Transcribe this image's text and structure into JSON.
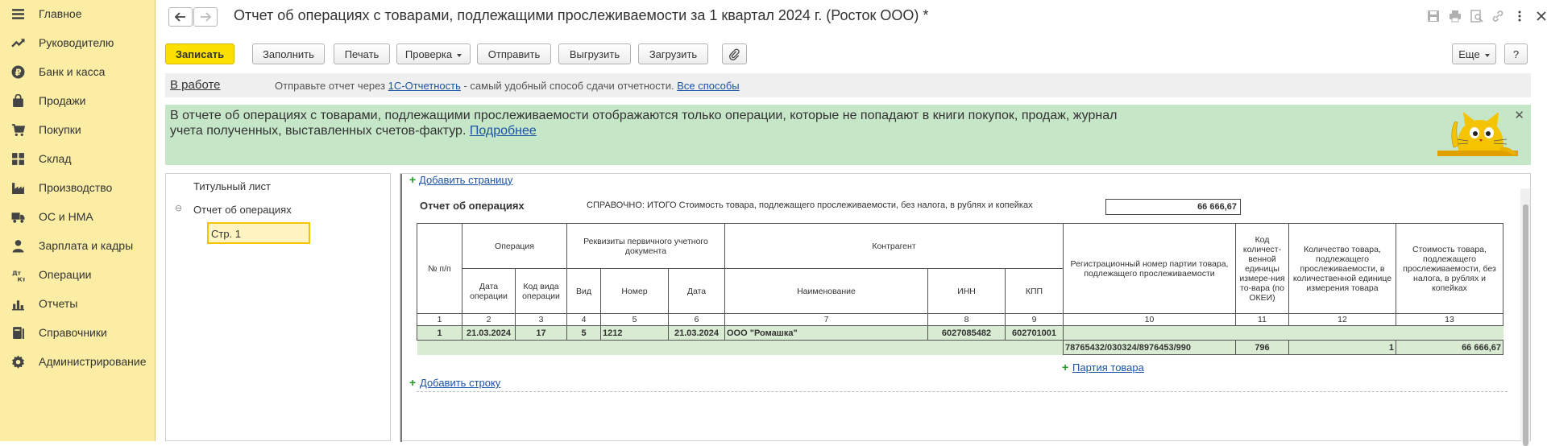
{
  "sidebar": {
    "items": [
      {
        "label": "Главное",
        "icon": "menu-icon"
      },
      {
        "label": "Руководителю",
        "icon": "trend-icon"
      },
      {
        "label": "Банк и касса",
        "icon": "ruble-icon"
      },
      {
        "label": "Продажи",
        "icon": "bag-icon"
      },
      {
        "label": "Покупки",
        "icon": "cart-icon"
      },
      {
        "label": "Склад",
        "icon": "grid-icon"
      },
      {
        "label": "Производство",
        "icon": "factory-icon"
      },
      {
        "label": "ОС и НМА",
        "icon": "truck-icon"
      },
      {
        "label": "Зарплата и кадры",
        "icon": "person-icon"
      },
      {
        "label": "Операции",
        "icon": "dtkt-icon"
      },
      {
        "label": "Отчеты",
        "icon": "barchart-icon"
      },
      {
        "label": "Справочники",
        "icon": "book-icon"
      },
      {
        "label": "Администрирование",
        "icon": "gear-icon"
      }
    ]
  },
  "header": {
    "title": "Отчет об операциях с товарами, подлежащими прослеживаемости за 1 квартал 2024 г. (Росток ООО) *"
  },
  "toolbar": {
    "save": "Записать",
    "fill": "Заполнить",
    "print": "Печать",
    "check": "Проверка",
    "send": "Отправить",
    "export": "Выгрузить",
    "import": "Загрузить",
    "more": "Еще",
    "help": "?"
  },
  "status": {
    "state": "В работе",
    "msg_prefix": "Отправьте отчет через ",
    "msg_link": "1С-Отчетность",
    "msg_middle": " - самый удобный способ сдачи отчетности. ",
    "msg_link2": "Все способы"
  },
  "banner": {
    "text": "В отчете об операциях с товарами, подлежащими прослеживаемости отображаются только операции, которые не попадают в книги покупок, продаж, журнал учета полученных, выставленных счетов-фактур. ",
    "link": "Подробнее"
  },
  "tree": {
    "title_page": "Титульный лист",
    "section": "Отчет об операциях",
    "page": "Стр. 1"
  },
  "form": {
    "add_page": "Добавить страницу",
    "section_title": "Отчет об операциях",
    "ref_label": "СПРАВОЧНО: ИТОГО Стоимость товара, подлежащего прослеживаемости, без налога, в рублях и копейках",
    "ref_total": "66 666,67",
    "add_row": "Добавить строку",
    "add_batch": "Партия товара",
    "columns": {
      "num": "№ п/п",
      "operation": "Операция",
      "op_date": "Дата операции",
      "op_code": "Код вида операции",
      "doc": "Реквизиты первичного учетного документа",
      "doc_type": "Вид",
      "doc_num": "Номер",
      "doc_date": "Дата",
      "counterparty": "Контрагент",
      "cp_name": "Наименование",
      "cp_inn": "ИНН",
      "cp_kpp": "КПП",
      "reg_num": "Регистрационный номер партии товара, подлежащего прослеживаемости",
      "unit_code": "Код количест-венной единицы измере-ния то-вара (по ОКЕИ)",
      "qty": "Количество товара, подлежащего прослеживаемости, в количественной единице измерения товара",
      "cost": "Стоимость товара, подлежащего прослеживаемости, без налога, в рублях и копейках"
    },
    "col_numbers": [
      "1",
      "2",
      "3",
      "4",
      "5",
      "6",
      "7",
      "8",
      "9",
      "10",
      "11",
      "12",
      "13"
    ],
    "row": {
      "num": "1",
      "op_date": "21.03.2024",
      "op_code": "17",
      "doc_type": "5",
      "doc_num": "1212",
      "doc_date": "21.03.2024",
      "cp_name": "ООО \"Ромашка\"",
      "cp_inn": "6027085482",
      "cp_kpp": "602701001"
    },
    "batch": {
      "reg_num": "78765432/030324/8976453/990",
      "unit_code": "796",
      "qty": "1",
      "cost": "66 666,67"
    }
  }
}
